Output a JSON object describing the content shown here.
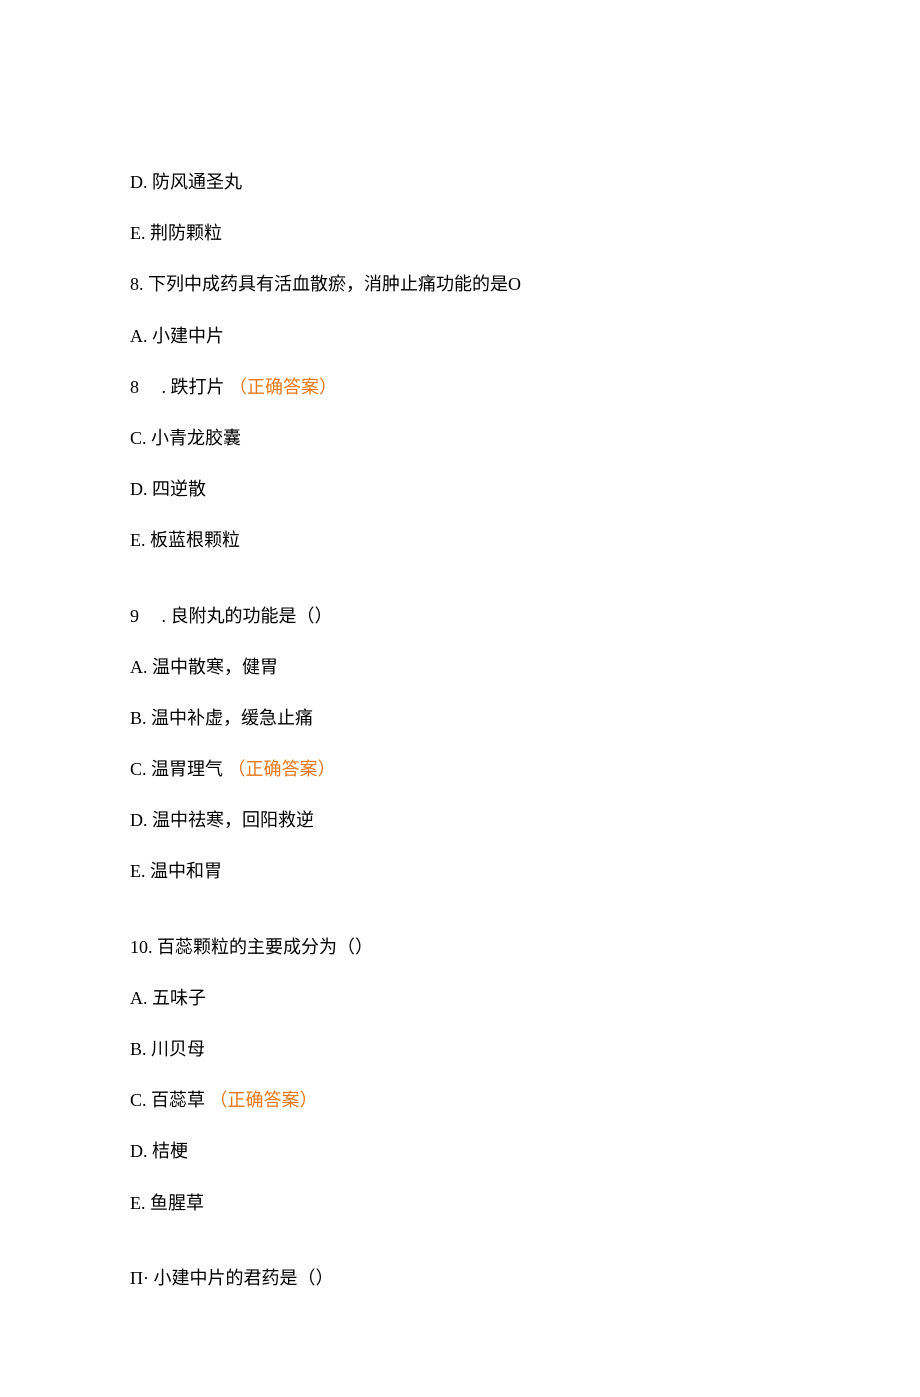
{
  "q7_tail": {
    "d_label": "D.",
    "d_text": "防风通圣丸",
    "e_label": "E.",
    "e_text": "荆防颗粒"
  },
  "q8": {
    "q_label": "8.",
    "q_text": "下列中成药具有活血散瘀，消肿止痛功能的是O",
    "a_label": "A.",
    "a_text": "小建中片",
    "b_label": "8",
    "b_dot": " .",
    "b_text": "跌打片",
    "b_correct": "（正确答案）",
    "c_label": "C.",
    "c_text": "小青龙胶囊",
    "d_label": "D.",
    "d_text": "四逆散",
    "e_label": "E.",
    "e_text": "板蓝根颗粒"
  },
  "q9": {
    "q_label": "9",
    "q_dot": " .",
    "q_text": "良附丸的功能是（）",
    "a_label": "A.",
    "a_text": "温中散寒，健胃",
    "b_label": "B.",
    "b_text": "温中补虚，缓急止痛",
    "c_label": "C.",
    "c_text": "温胃理气",
    "c_correct": "（正确答案）",
    "d_label": "D.",
    "d_text": "温中祛寒，回阳救逆",
    "e_label": "E.",
    "e_text": "温中和胃"
  },
  "q10": {
    "q_label": "10.",
    "q_text": "百蕊颗粒的主要成分为（）",
    "a_label": "A.",
    "a_text": "五味子",
    "b_label": "B.",
    "b_text": "川贝母",
    "c_label": "C.",
    "c_text": "百蕊草",
    "c_correct": "（正确答案）",
    "d_label": "D.",
    "d_text": "桔梗",
    "e_label": "E.",
    "e_text": "鱼腥草"
  },
  "q11": {
    "q_label": "Π·",
    "q_text": "小建中片的君药是（）"
  }
}
